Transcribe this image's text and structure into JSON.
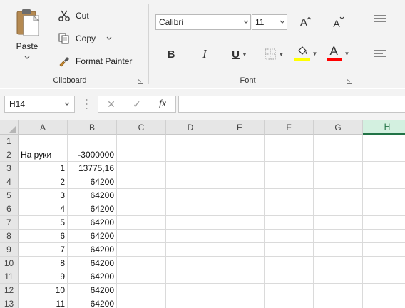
{
  "clipboard": {
    "paste_label": "Paste",
    "cut_label": "Cut",
    "copy_label": "Copy",
    "format_painter_label": "Format Painter",
    "group_label": "Clipboard"
  },
  "font": {
    "font_name": "Calibri",
    "font_size": "11",
    "group_label": "Font",
    "bold_glyph": "B",
    "italic_glyph": "I",
    "underline_glyph": "U",
    "grow_glyph": "A",
    "shrink_glyph": "A",
    "font_color_glyph": "A",
    "highlight_color": "#ffff00",
    "font_color": "#ff0000"
  },
  "formula_bar": {
    "name_box": "H14",
    "cancel_glyph": "✕",
    "enter_glyph": "✓",
    "fx_glyph": "fx",
    "formula": ""
  },
  "sheet": {
    "columns": [
      "A",
      "B",
      "C",
      "D",
      "E",
      "F",
      "G",
      "H"
    ],
    "selected_column": "H",
    "rows": [
      {
        "num": "1",
        "a": "",
        "b": ""
      },
      {
        "num": "2",
        "a": "На руки",
        "b": "-3000000"
      },
      {
        "num": "3",
        "a": "1",
        "b": "13775,16"
      },
      {
        "num": "4",
        "a": "2",
        "b": "64200"
      },
      {
        "num": "5",
        "a": "3",
        "b": "64200"
      },
      {
        "num": "6",
        "a": "4",
        "b": "64200"
      },
      {
        "num": "7",
        "a": "5",
        "b": "64200"
      },
      {
        "num": "8",
        "a": "6",
        "b": "64200"
      },
      {
        "num": "9",
        "a": "7",
        "b": "64200"
      },
      {
        "num": "10",
        "a": "8",
        "b": "64200"
      },
      {
        "num": "11",
        "a": "9",
        "b": "64200"
      },
      {
        "num": "12",
        "a": "10",
        "b": "64200"
      },
      {
        "num": "13",
        "a": "11",
        "b": "64200"
      }
    ]
  },
  "colors": {
    "accent": "#217346"
  }
}
